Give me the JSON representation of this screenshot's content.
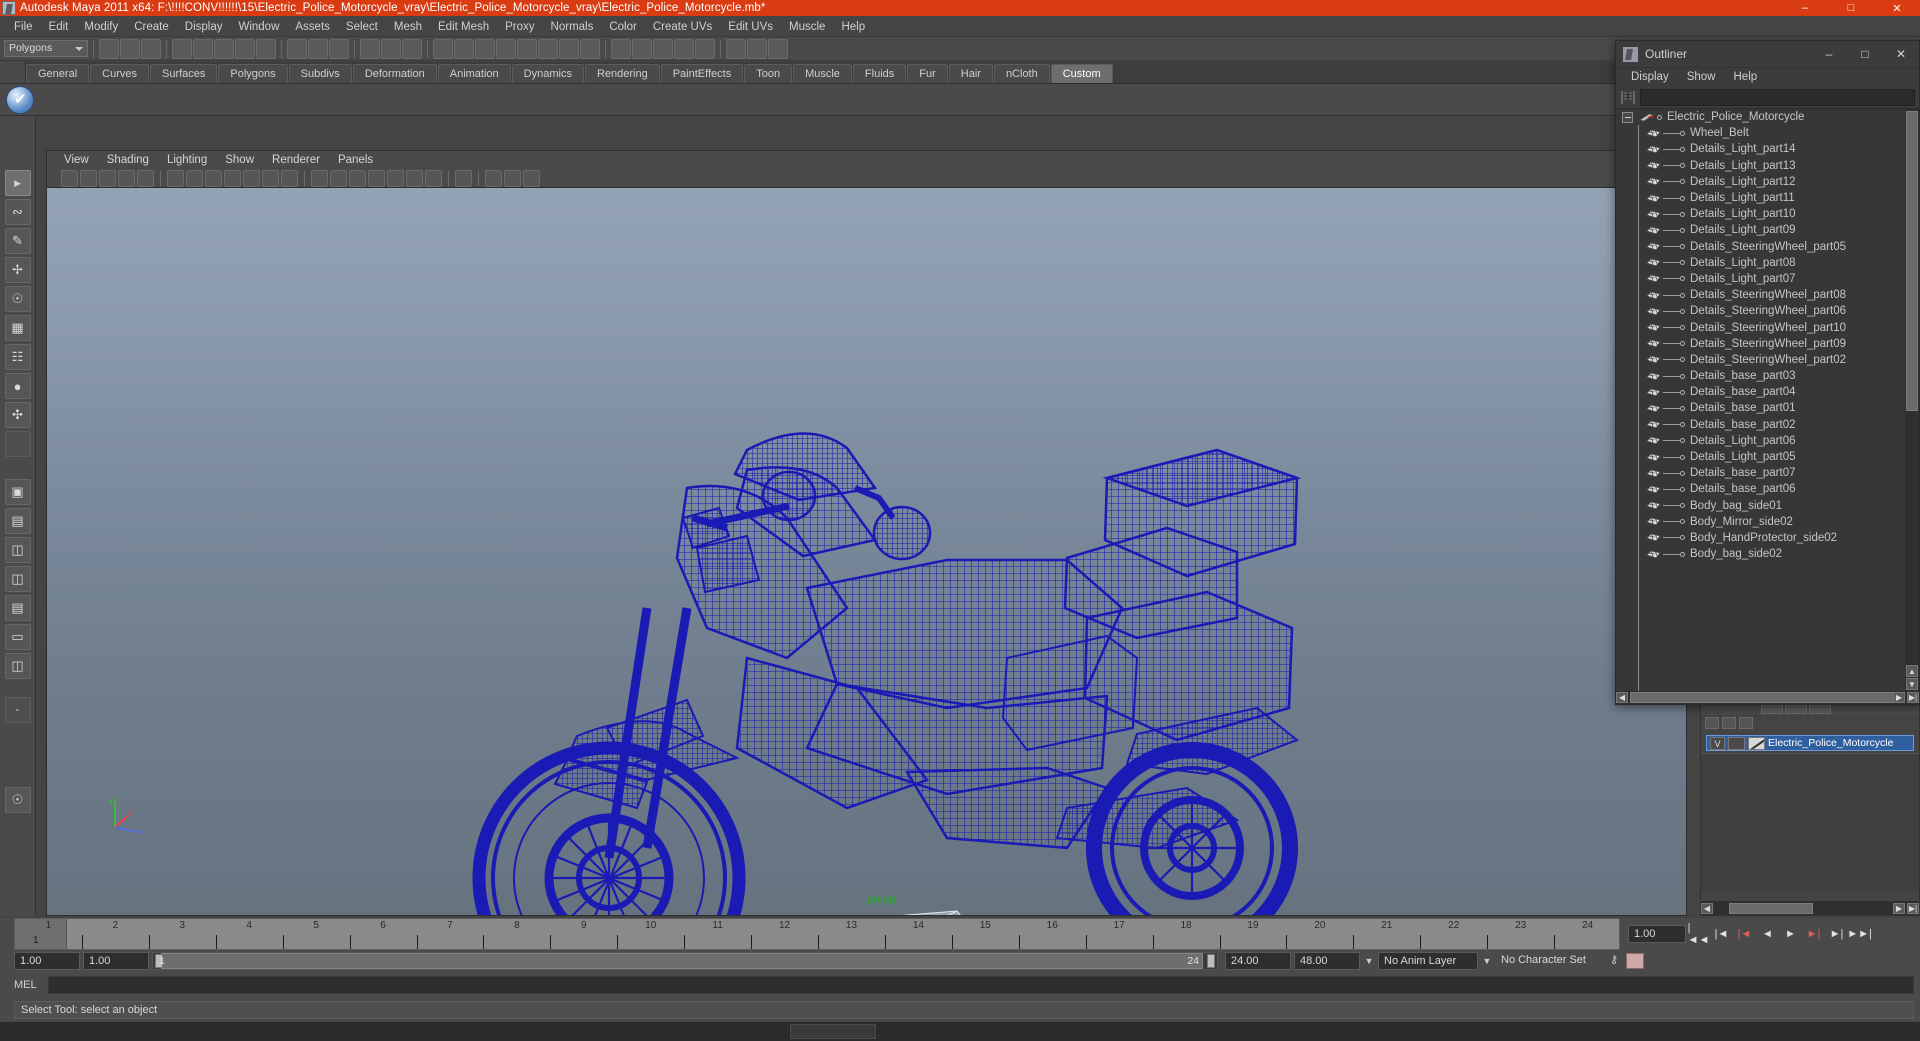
{
  "window": {
    "title": "Autodesk Maya 2011 x64: F:\\!!!!CONV!!!!!!\\15\\Electric_Police_Motorcycle_vray\\Electric_Police_Motorcycle_vray\\Electric_Police_Motorcycle.mb*",
    "app_icon": "maya-icon",
    "minimize": "–",
    "maximize": "□",
    "close": "✕",
    "title_bar_color": "#d93c12"
  },
  "menubar": {
    "items": [
      "File",
      "Edit",
      "Modify",
      "Create",
      "Display",
      "Window",
      "Assets",
      "Select",
      "Mesh",
      "Edit Mesh",
      "Proxy",
      "Normals",
      "Color",
      "Create UVs",
      "Edit UVs",
      "Muscle",
      "Help"
    ]
  },
  "statusline": {
    "selection_mode": "Polygons"
  },
  "shelf": {
    "tabs": [
      "General",
      "Curves",
      "Surfaces",
      "Polygons",
      "Subdivs",
      "Deformation",
      "Animation",
      "Dynamics",
      "Rendering",
      "PaintEffects",
      "Toon",
      "Muscle",
      "Fluids",
      "Fur",
      "Hair",
      "nCloth",
      "Custom"
    ],
    "active_tab": "Custom"
  },
  "viewport": {
    "menus": [
      "View",
      "Shading",
      "Lighting",
      "Show",
      "Renderer",
      "Panels"
    ],
    "camera_label": "persp",
    "camera_label_color": "#2ea82e",
    "axis_labels": {
      "y": "y",
      "x": "x",
      "z": "z"
    },
    "background_top": "#93a2b4",
    "background_bottom": "#66737f",
    "model_wireframe_color": "#1a1ab4"
  },
  "outliner": {
    "title": "Outliner",
    "window_icon": "maya-icon",
    "minimize": "–",
    "maximize": "□",
    "close": "✕",
    "menus": [
      "Display",
      "Show",
      "Help"
    ],
    "search_value": "",
    "search_placeholder": "",
    "root": "Electric_Police_Motorcycle",
    "items": [
      "Wheel_Belt",
      "Details_Light_part14",
      "Details_Light_part13",
      "Details_Light_part12",
      "Details_Light_part11",
      "Details_Light_part10",
      "Details_Light_part09",
      "Details_SteeringWheel_part05",
      "Details_Light_part08",
      "Details_Light_part07",
      "Details_SteeringWheel_part08",
      "Details_SteeringWheel_part06",
      "Details_SteeringWheel_part10",
      "Details_SteeringWheel_part09",
      "Details_SteeringWheel_part02",
      "Details_base_part03",
      "Details_base_part04",
      "Details_base_part01",
      "Details_base_part02",
      "Details_Light_part06",
      "Details_Light_part05",
      "Details_base_part07",
      "Details_base_part06",
      "Body_bag_side01",
      "Body_Mirror_side02",
      "Body_HandProtector_side02",
      "Body_bag_side02"
    ]
  },
  "layer_editor": {
    "visibility_toggle": "V",
    "layer_name": "Electric_Police_Motorcycle"
  },
  "timeline": {
    "ticks": [
      "1",
      "2",
      "3",
      "4",
      "5",
      "6",
      "7",
      "8",
      "9",
      "10",
      "11",
      "12",
      "13",
      "14",
      "15",
      "16",
      "17",
      "18",
      "19",
      "20",
      "21",
      "22",
      "23",
      "24"
    ],
    "current_frame_label": "1",
    "current_frame_value": "1.00",
    "playback_buttons": [
      "go-to-start",
      "step-back-key",
      "step-back-frame",
      "play-backwards",
      "play-forwards",
      "step-forward-frame",
      "step-forward-key",
      "go-to-end"
    ]
  },
  "rangeslider": {
    "anim_start": "1.00",
    "anim_end": "1.00",
    "range_start_label": "1",
    "range_end_label": "24",
    "playback_end": "24.00",
    "anim_end_total": "48.00",
    "anim_layer": "No Anim Layer",
    "character_set": "No Character Set"
  },
  "command_line": {
    "label": "MEL",
    "value": "",
    "placeholder": ""
  },
  "help_line": {
    "message": "Select Tool: select an object"
  }
}
